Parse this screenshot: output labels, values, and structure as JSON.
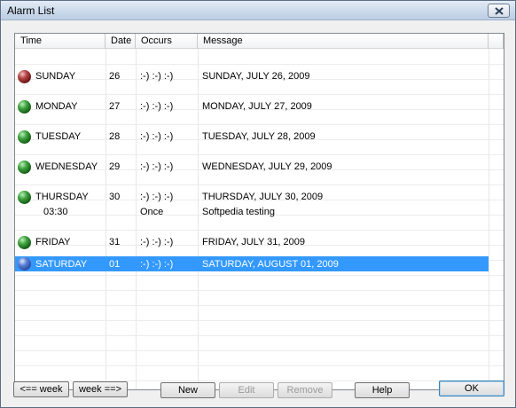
{
  "window": {
    "title": "Alarm List"
  },
  "list": {
    "columns": [
      "Time",
      "Date",
      "Occurs",
      "Message"
    ],
    "rows": [
      {
        "day": "SUNDAY",
        "date": "26",
        "occurs": ":-)  :-)  :-)",
        "message": "SUNDAY, JULY 26, 2009",
        "status": "red",
        "selected": false
      },
      {
        "day": "MONDAY",
        "date": "27",
        "occurs": ":-)  :-)  :-)",
        "message": "MONDAY, JULY 27, 2009",
        "status": "green",
        "selected": false
      },
      {
        "day": "TUESDAY",
        "date": "28",
        "occurs": ":-)  :-)  :-)",
        "message": "TUESDAY, JULY 28, 2009",
        "status": "green",
        "selected": false
      },
      {
        "day": "WEDNESDAY",
        "date": "29",
        "occurs": ":-)  :-)  :-)",
        "message": "WEDNESDAY, JULY 29, 2009",
        "status": "green",
        "selected": false
      },
      {
        "day": "THURSDAY",
        "date": "30",
        "occurs": ":-)  :-)  :-)",
        "message": "THURSDAY, JULY 30, 2009",
        "status": "green",
        "selected": false
      },
      {
        "day": "FRIDAY",
        "date": "31",
        "occurs": ":-)  :-)  :-)",
        "message": "FRIDAY, JULY 31, 2009",
        "status": "green",
        "selected": false
      },
      {
        "day": "SATURDAY",
        "date": "01",
        "occurs": ":-)  :-)  :-)",
        "message": "SATURDAY, AUGUST 01, 2009",
        "status": "blue",
        "selected": true
      }
    ],
    "alarm": {
      "time": "03:30",
      "occurs": "Once",
      "message": "Softpedia testing"
    }
  },
  "buttons": {
    "prev_week": "<== week",
    "next_week": "week ==>",
    "new": "New",
    "edit": "Edit",
    "remove": "Remove",
    "help": "Help",
    "ok": "OK"
  },
  "colors": {
    "selection": "#3399ff",
    "title_gradient_top": "#e3ecf7"
  }
}
